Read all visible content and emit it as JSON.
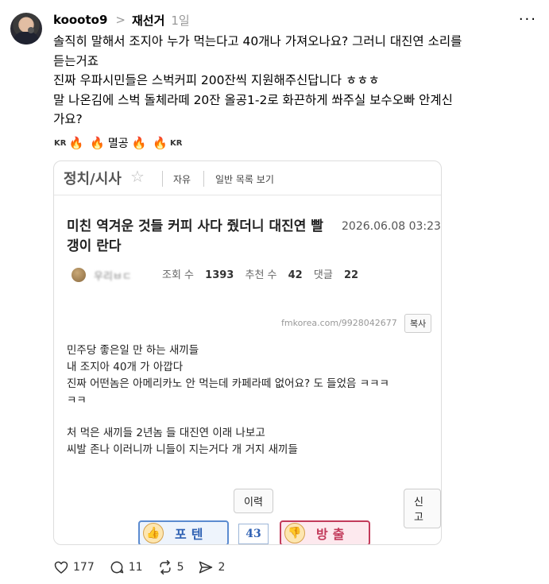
{
  "post": {
    "username": "koooto9",
    "topic": "재선거",
    "time": "1일",
    "lines": [
      "솔직히 말해서 조지아 누가 먹는다고 40개나 가져오나요? 그러니 대진연 소리를",
      "듣는거죠",
      "진짜 우파시민들은 스벅커피 200잔씩 지원해주신답니다 ㅎㅎㅎ",
      "말 나온김에 스벅 돌체라떼 20잔 올공1-2로 화끈하게 쏴주실 보수오빠 안계신",
      "가요?"
    ],
    "emoji_kr": "KR",
    "emoji_word": "멸공"
  },
  "embed": {
    "board": "정치/시사",
    "category": "자유",
    "list_view": "일반 목록 보기",
    "title": "미친 역겨운 것들 커피 사다 줬더니 대진연 빨갱이 란다",
    "date": "2026.06.08 03:23",
    "author": "우리ㅂㄷ",
    "views_label": "조회 수",
    "views": "1393",
    "recommends_label": "추천 수",
    "recommends": "42",
    "comments_label": "댓글",
    "comments": "22",
    "url": "fmkorea.com/9928042677",
    "copy": "복사",
    "body": [
      "민주당 좋은일 만 하는 새끼들",
      "내 조지아 40개 가 아깝다",
      "진짜 어떤놈은 아메리카노 안 먹는데 카페라떼 없어요? 도 들었음 ㅋㅋㅋ",
      "ㅋㅋ",
      "처 먹은 새끼들 2년놈 들 대진연 이래 나보고",
      "씨발 존나 이러니까 니들이 지는거다 개 거지 새끼들"
    ],
    "history": "이력",
    "report": "신고",
    "upvote_label": "포텐",
    "vote_count": "43",
    "downvote_label": "방출"
  },
  "actions": {
    "likes": "177",
    "comments": "11",
    "reposts": "5",
    "shares": "2"
  }
}
